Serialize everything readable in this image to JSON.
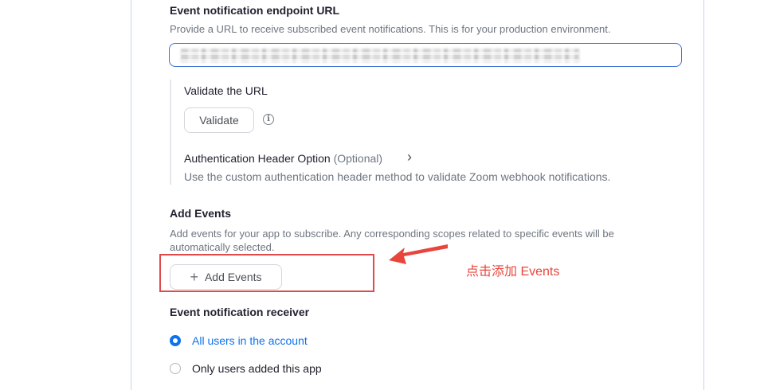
{
  "endpoint": {
    "title": "Event notification endpoint URL",
    "description": "Provide a URL to receive subscribed event notifications. This is for your production environment."
  },
  "validate": {
    "title": "Validate the URL",
    "button_label": "Validate",
    "info_glyph": "i"
  },
  "auth_header": {
    "title": "Authentication Header Option",
    "optional": "(Optional)",
    "chevron": "›",
    "description": "Use the custom authentication header method to validate Zoom webhook notifications."
  },
  "add_events": {
    "title": "Add Events",
    "description_line1": "Add events for your app to subscribe. Any corresponding scopes related to specific events will be",
    "description_line2": "automatically selected.",
    "plus": "+",
    "button_label": "Add Events"
  },
  "annotation": {
    "text": "点击添加 Events",
    "color": "#e8453c"
  },
  "receiver": {
    "title": "Event notification receiver",
    "options": [
      {
        "label": "All users in the account",
        "selected": true
      },
      {
        "label": "Only users added this app",
        "selected": false
      }
    ]
  },
  "colors": {
    "accent": "#0e72ed",
    "annotation_red": "#e04a4a"
  }
}
